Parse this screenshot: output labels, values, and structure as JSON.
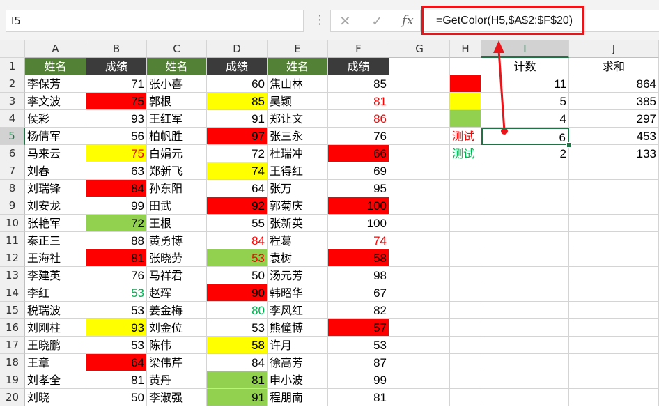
{
  "toolbar": {
    "name_box": "I5",
    "dots": "⋮",
    "cancel_glyph": "✕",
    "confirm_glyph": "✓",
    "fx_glyph": "fx",
    "formula": "=GetColor(H5,$A$2:$F$20)"
  },
  "columns": [
    "A",
    "B",
    "C",
    "D",
    "E",
    "F",
    "G",
    "H",
    "I",
    "J"
  ],
  "rows": [
    "1",
    "2",
    "3",
    "4",
    "5",
    "6",
    "7",
    "8",
    "9",
    "10",
    "11",
    "12",
    "13",
    "14",
    "15",
    "16",
    "17",
    "18",
    "19",
    "20"
  ],
  "headers": [
    "姓名",
    "成绩",
    "姓名",
    "成绩",
    "姓名",
    "成绩"
  ],
  "header_colors": {
    "name": "#538135",
    "score": "#3b3b3b"
  },
  "fill_colors": {
    "red": "#ff0000",
    "yellow": "#ffff00",
    "green": "#92d050"
  },
  "font_colors": {
    "red": "#ff0000",
    "green": "#00b050"
  },
  "table": [
    [
      [
        "李保芳"
      ],
      [
        "71"
      ],
      [
        "张小喜"
      ],
      [
        "60"
      ],
      [
        "焦山林"
      ],
      [
        "85"
      ]
    ],
    [
      [
        "李文波"
      ],
      [
        "75",
        "red"
      ],
      [
        "郭根"
      ],
      [
        "85",
        "yellow"
      ],
      [
        "吴颖"
      ],
      [
        "81",
        "",
        "red"
      ]
    ],
    [
      [
        "侯彩"
      ],
      [
        "93"
      ],
      [
        "王红军"
      ],
      [
        "91"
      ],
      [
        "郑让文"
      ],
      [
        "86",
        "",
        "red"
      ]
    ],
    [
      [
        "杨倩军"
      ],
      [
        "56"
      ],
      [
        "柏帆胜"
      ],
      [
        "97",
        "red"
      ],
      [
        "张三永"
      ],
      [
        "76"
      ]
    ],
    [
      [
        "马来云"
      ],
      [
        "75",
        "yellow",
        "red"
      ],
      [
        "白娟元"
      ],
      [
        "72"
      ],
      [
        "杜瑞冲"
      ],
      [
        "66",
        "red"
      ]
    ],
    [
      [
        "刘春"
      ],
      [
        "63"
      ],
      [
        "郑新飞"
      ],
      [
        "74",
        "yellow"
      ],
      [
        "王得红"
      ],
      [
        "69"
      ]
    ],
    [
      [
        "刘瑞锋"
      ],
      [
        "84",
        "red"
      ],
      [
        "孙东阳"
      ],
      [
        "64"
      ],
      [
        "张万"
      ],
      [
        "95"
      ]
    ],
    [
      [
        "刘安龙"
      ],
      [
        "99"
      ],
      [
        "田武"
      ],
      [
        "92",
        "red"
      ],
      [
        "郭菊庆"
      ],
      [
        "100",
        "red"
      ]
    ],
    [
      [
        "张艳军"
      ],
      [
        "72",
        "green"
      ],
      [
        "王根"
      ],
      [
        "55"
      ],
      [
        "张新英"
      ],
      [
        "100"
      ]
    ],
    [
      [
        "秦正三"
      ],
      [
        "88"
      ],
      [
        "黄勇博"
      ],
      [
        "84",
        "",
        "red"
      ],
      [
        "程葛"
      ],
      [
        "74",
        "",
        "red"
      ]
    ],
    [
      [
        "王海社"
      ],
      [
        "81",
        "red"
      ],
      [
        "张晓劳"
      ],
      [
        "53",
        "green",
        "red"
      ],
      [
        "袁树"
      ],
      [
        "58",
        "red"
      ]
    ],
    [
      [
        "李建英"
      ],
      [
        "76"
      ],
      [
        "马祥君"
      ],
      [
        "50"
      ],
      [
        "汤元芳"
      ],
      [
        "98"
      ]
    ],
    [
      [
        "李红"
      ],
      [
        "53",
        "",
        "green"
      ],
      [
        "赵珲"
      ],
      [
        "90",
        "red"
      ],
      [
        "韩昭华"
      ],
      [
        "67"
      ]
    ],
    [
      [
        "税瑞波"
      ],
      [
        "53"
      ],
      [
        "姜金梅"
      ],
      [
        "80",
        "",
        "green"
      ],
      [
        "李风红"
      ],
      [
        "82"
      ]
    ],
    [
      [
        "刘刚柱"
      ],
      [
        "93",
        "yellow"
      ],
      [
        "刘金位"
      ],
      [
        "53"
      ],
      [
        "熊僮博"
      ],
      [
        "57",
        "red"
      ]
    ],
    [
      [
        "王晓鹏"
      ],
      [
        "53"
      ],
      [
        "陈伟"
      ],
      [
        "58",
        "yellow"
      ],
      [
        "许月"
      ],
      [
        "53"
      ]
    ],
    [
      [
        "王章"
      ],
      [
        "64",
        "red"
      ],
      [
        "梁伟芹"
      ],
      [
        "84"
      ],
      [
        "徐高芳"
      ],
      [
        "87"
      ]
    ],
    [
      [
        "刘孝全"
      ],
      [
        "81"
      ],
      [
        "黄丹"
      ],
      [
        "81",
        "green"
      ],
      [
        "申小波"
      ],
      [
        "99"
      ]
    ],
    [
      [
        "刘晓"
      ],
      [
        "50"
      ],
      [
        "李淑强"
      ],
      [
        "91",
        "green"
      ],
      [
        "程朋南"
      ],
      [
        "81"
      ]
    ]
  ],
  "summary": {
    "headers": {
      "count": "计数",
      "sum": "求和"
    },
    "rows": [
      {
        "label": "",
        "fill": "red",
        "font": "",
        "count": "11",
        "sum": "864"
      },
      {
        "label": "",
        "fill": "yellow",
        "font": "",
        "count": "5",
        "sum": "385"
      },
      {
        "label": "",
        "fill": "green",
        "font": "",
        "count": "4",
        "sum": "297"
      },
      {
        "label": "测试",
        "fill": "",
        "font": "red",
        "count": "6",
        "sum": "453"
      },
      {
        "label": "测试",
        "fill": "",
        "font": "green",
        "count": "2",
        "sum": "133"
      }
    ]
  },
  "active_cell": "I5",
  "annotation_color": "#e8151a"
}
